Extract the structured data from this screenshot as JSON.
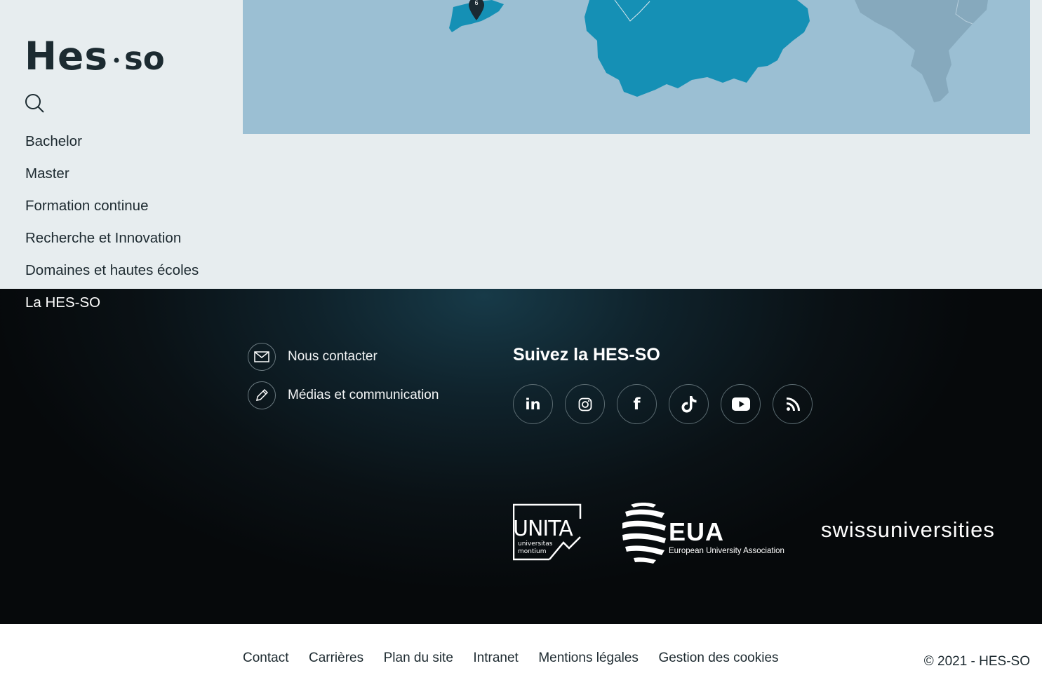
{
  "brand": {
    "logo_text_left": "Hes",
    "logo_text_right": "so"
  },
  "map": {
    "marker_number": "6",
    "colors": {
      "water": "#9bbfd3",
      "region_highlight": "#1590b5",
      "region_muted": "#86a9bd",
      "marker": "#1a2a33"
    }
  },
  "sidebar": {
    "search_icon": "search-icon",
    "items": [
      {
        "label": "Bachelor"
      },
      {
        "label": "Master"
      },
      {
        "label": "Formation continue"
      },
      {
        "label": "Recherche et Innovation"
      },
      {
        "label": "Domaines et hautes écoles"
      },
      {
        "label": "La HES-SO"
      }
    ]
  },
  "footer": {
    "contact": {
      "label": "Nous contacter",
      "icon": "envelope-icon"
    },
    "media": {
      "label": "Médias et communication",
      "icon": "pencil-icon"
    },
    "follow_title": "Suivez la HES-SO",
    "socials": [
      {
        "icon": "linkedin-icon",
        "text": "in"
      },
      {
        "icon": "instagram-icon"
      },
      {
        "icon": "facebook-icon",
        "text": "f"
      },
      {
        "icon": "tiktok-icon"
      },
      {
        "icon": "youtube-icon"
      },
      {
        "icon": "rss-icon"
      }
    ],
    "partners": {
      "unita": {
        "title": "UNITA",
        "subtitle_1": "universitas",
        "subtitle_2": "montium"
      },
      "eua": {
        "title": "EUA",
        "subtitle": "European University Association"
      },
      "swiss": {
        "text": "swissuniversities"
      }
    }
  },
  "bottom_bar": {
    "links": [
      "Contact",
      "Carrières",
      "Plan du site",
      "Intranet",
      "Mentions légales",
      "Gestion des cookies"
    ],
    "copyright": "© 2021 - HES-SO"
  }
}
